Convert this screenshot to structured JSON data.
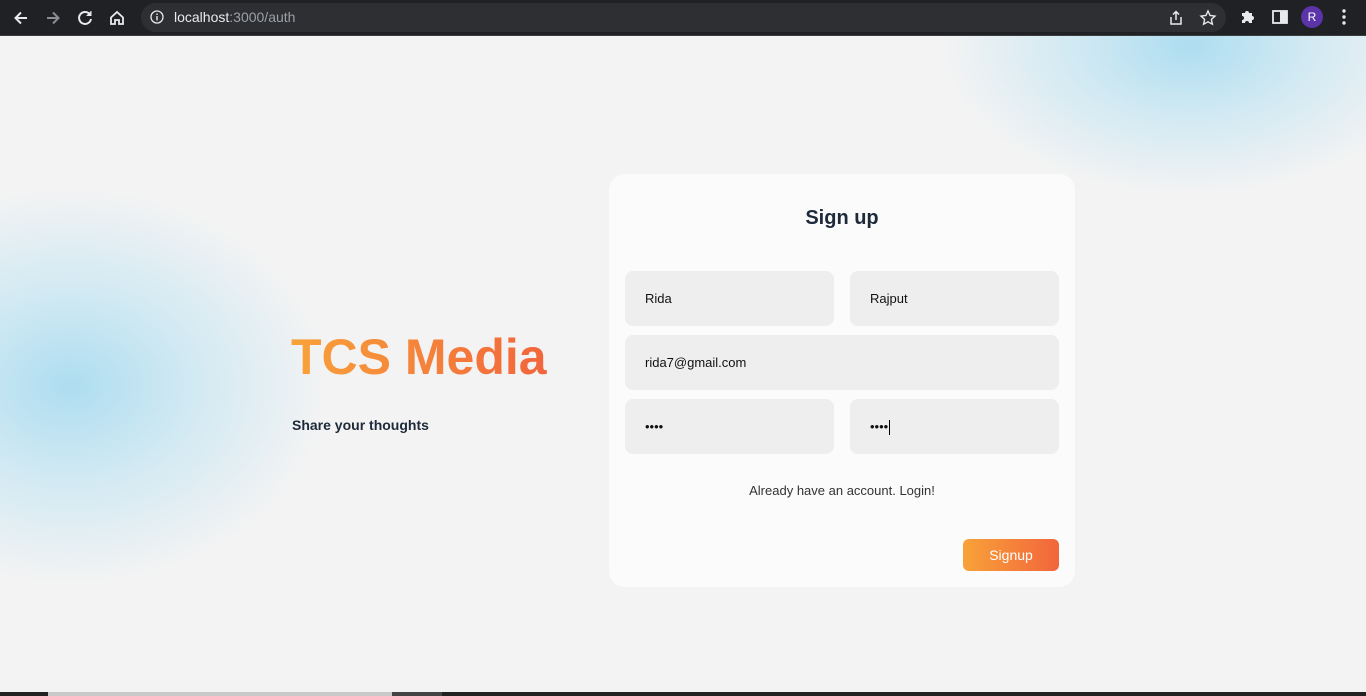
{
  "browser": {
    "url_host": "localhost",
    "url_path": ":3000/auth",
    "profile_initial": "R",
    "icons": [
      "back-icon",
      "forward-icon",
      "reload-icon",
      "home-icon",
      "info-icon",
      "share-icon",
      "star-icon",
      "extensions-icon",
      "side-panel-icon",
      "menu-icon"
    ]
  },
  "hero": {
    "brand": "TCS Media",
    "tagline": "Share your thoughts"
  },
  "form": {
    "title": "Sign up",
    "first_name": "Rida",
    "last_name": "Rajput",
    "email": "rida7@gmail.com",
    "password": "••••",
    "confirm_password": "••••",
    "login_link": "Already have an account. Login!",
    "submit_label": "Signup"
  },
  "colors": {
    "accent_start": "#f8a23a",
    "accent_end": "#f2653b",
    "text_dark": "#1e2a3a",
    "chrome_bg": "#202124"
  }
}
